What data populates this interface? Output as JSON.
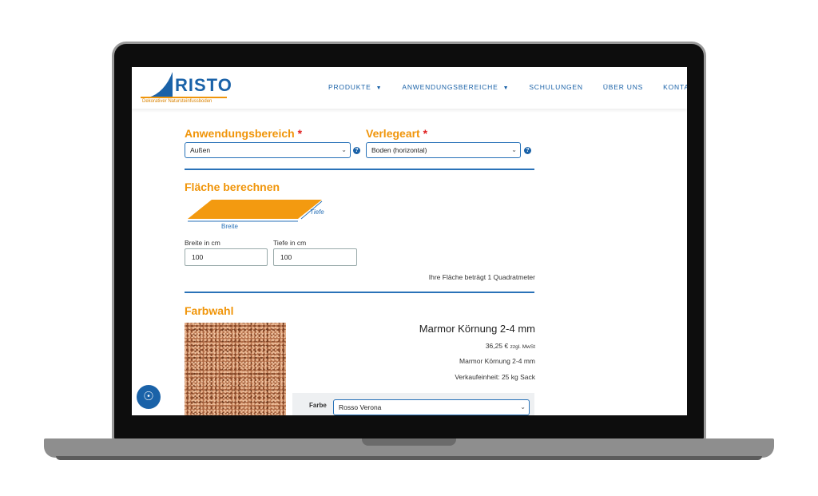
{
  "logo": {
    "brand": "RISTO",
    "tagline": "Dekorativer Natursteinfussboden"
  },
  "nav": {
    "items": [
      {
        "label": "PRODUKTE",
        "has_dropdown": true
      },
      {
        "label": "ANWENDUNGSBEREICHE",
        "has_dropdown": true
      },
      {
        "label": "SCHULUNGEN",
        "has_dropdown": false
      },
      {
        "label": "ÜBER UNS",
        "has_dropdown": false
      },
      {
        "label": "KONTAKT",
        "has_dropdown": true
      }
    ]
  },
  "form": {
    "anwendungsbereich": {
      "label": "Anwendungsbereich",
      "required_mark": "*",
      "value": "Außen"
    },
    "verlegeart": {
      "label": "Verlegeart",
      "required_mark": "*",
      "value": "Boden (horizontal)"
    },
    "help_icon": "?"
  },
  "flaeche": {
    "heading": "Fläche berechnen",
    "diagram": {
      "width_label": "Breite",
      "depth_label": "Tiefe",
      "fill_color": "#f39a10",
      "line_color": "#2a72b8"
    },
    "breite_label": "Breite in cm",
    "breite_value": "100",
    "tiefe_label": "Tiefe in cm",
    "tiefe_value": "100",
    "result": "Ihre Fläche beträgt 1 Quadratmeter"
  },
  "farbwahl": {
    "heading": "Farbwahl",
    "product_title": "Marmor Körnung 2-4 mm",
    "price": "36,25 €",
    "price_note": "zzgl. MwSt",
    "product_name": "Marmor Körnung 2-4 mm",
    "unit": "Verkaufeinheit: 25 kg Sack",
    "farbe_label": "Farbe",
    "farbe_value": "Rosso Verona"
  },
  "colors": {
    "accent_orange": "#f0950a",
    "brand_blue": "#1a62a8",
    "required_red": "#e02020"
  },
  "icons": {
    "chat": "fingerprint-icon",
    "dropdown": "chevron-down-icon"
  }
}
